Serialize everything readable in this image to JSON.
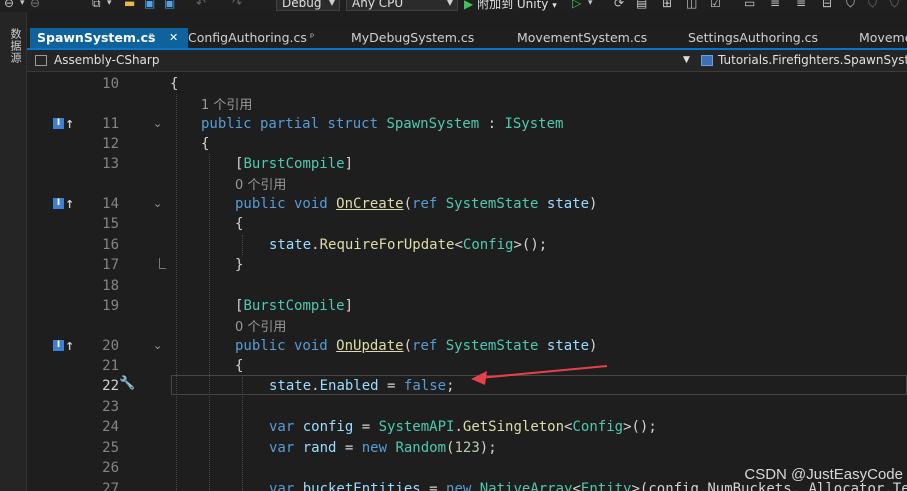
{
  "toolbar": {
    "config_select": "Debug",
    "platform_select": "Any CPU",
    "attach_label": "附加到 Unity"
  },
  "left_strip": {
    "vertical_label": "数据源"
  },
  "tabs": [
    {
      "label": "SpawnSystem.cs",
      "active": true
    },
    {
      "label": "ConfigAuthoring.cs"
    },
    {
      "label": "MyDebugSystem.cs"
    },
    {
      "label": "MovementSystem.cs"
    },
    {
      "label": "SettingsAuthoring.cs"
    },
    {
      "label": "Moveme"
    }
  ],
  "navbar": {
    "project": "Assembly-CSharp",
    "type": "Tutorials.Firefighters.SpawnSyste"
  },
  "editor": {
    "current_line": 22,
    "line_numbers": [
      10,
      11,
      12,
      13,
      14,
      15,
      16,
      17,
      18,
      19,
      20,
      21,
      22,
      23,
      24,
      25,
      26,
      27
    ],
    "lens": {
      "struct_refs": "1 个引用",
      "oncreate_refs": "0 个引用",
      "onupdate_refs": "0 个引用"
    },
    "code": {
      "l10": "{",
      "l11_kw": "public partial struct ",
      "l11_name": "SpawnSystem",
      "l11_colon": " : ",
      "l11_iface": "ISystem",
      "l12": "{",
      "l13_open": "[",
      "l13_attr": "BurstCompile",
      "l13_close": "]",
      "l14_kw": "public void ",
      "l14_fn": "OnCreate",
      "l14_p1": "(",
      "l14_ref": "ref ",
      "l14_ty": "SystemState",
      "l14_arg": " state",
      "l14_p2": ")",
      "l15": "{",
      "l16_id": "state",
      "l16_dot": ".",
      "l16_fn": "RequireForUpdate",
      "l16_lt": "<",
      "l16_ty": "Config",
      "l16_rest": ">();",
      "l17": "}",
      "l19_open": "[",
      "l19_attr": "BurstCompile",
      "l19_close": "]",
      "l20_kw": "public void ",
      "l20_fn": "OnUpdate",
      "l20_p1": "(",
      "l20_ref": "ref ",
      "l20_ty": "SystemState",
      "l20_arg": " state",
      "l20_p2": ")",
      "l21": "{",
      "l22_id": "state",
      "l22_dot": ".",
      "l22_prop": "Enabled",
      "l22_eq": " = ",
      "l22_val": "false",
      "l22_end": ";",
      "l24_kw": "var ",
      "l24_id": "config",
      "l24_eq": " = ",
      "l24_ty": "SystemAPI",
      "l24_dot": ".",
      "l24_fn": "GetSingleton",
      "l24_lt": "<",
      "l24_ty2": "Config",
      "l24_rest": ">();",
      "l25_kw": "var ",
      "l25_id": "rand",
      "l25_eq": " = ",
      "l25_new": "new ",
      "l25_ty": "Random",
      "l25_p1": "(",
      "l25_num": "123",
      "l25_rest": ");",
      "l27_kw": "var ",
      "l27_id": "bucketEntities",
      "l27_eq": " = ",
      "l27_new": "new ",
      "l27_ty": "NativeArray",
      "l27_lt": "<",
      "l27_ty2": "Entity",
      "l27_rest": ">(config.NumBuckets, Allocator.Tem"
    }
  },
  "watermark": "CSDN @JustEasyCode",
  "colors": {
    "background": "#1e1e1e",
    "keyword": "#569cd6",
    "type": "#4ec9b0",
    "function": "#dcdcaa",
    "identifier": "#9cdcfe",
    "number": "#b5cea8",
    "annotation_arrow": "#e8404a",
    "active_tab": "#0e639c"
  }
}
